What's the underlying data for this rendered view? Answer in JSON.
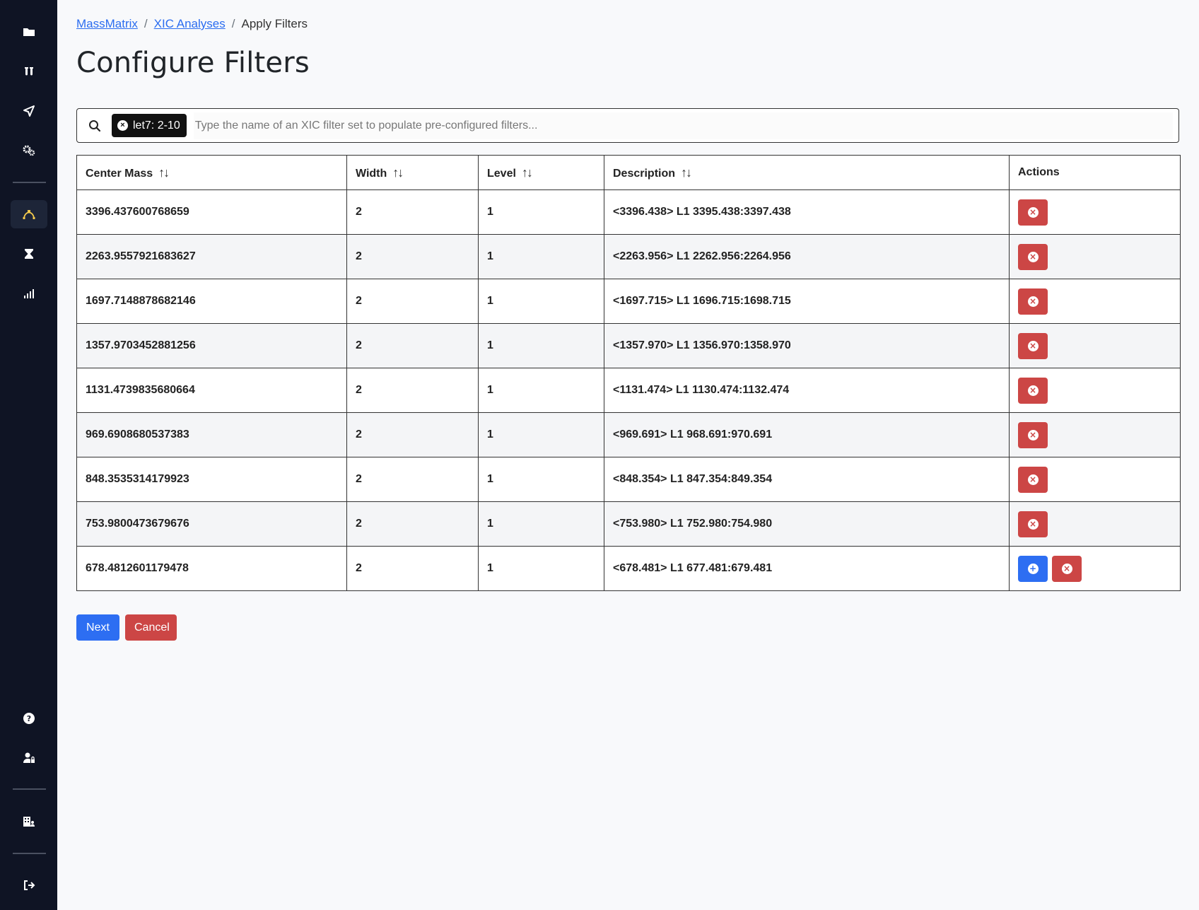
{
  "sidebar": {
    "top_items": [
      {
        "name": "folder",
        "active": false
      },
      {
        "name": "test-tubes",
        "active": false
      },
      {
        "name": "send",
        "active": false
      },
      {
        "name": "gears",
        "active": false
      }
    ],
    "mid_items": [
      {
        "name": "bezier-curve",
        "active": true
      },
      {
        "name": "hourglass",
        "active": false
      },
      {
        "name": "signal",
        "active": false
      }
    ],
    "bottom_items": [
      {
        "name": "help"
      },
      {
        "name": "user-lock"
      },
      {
        "name": "building-user"
      },
      {
        "name": "logout"
      }
    ]
  },
  "breadcrumb": {
    "items": [
      "MassMatrix",
      "XIC Analyses",
      "Apply Filters"
    ],
    "separator": "/"
  },
  "page_title": "Configure Filters",
  "search": {
    "chip_label": "let7: 2-10",
    "placeholder": "Type the name of an XIC filter set to populate pre-configured filters..."
  },
  "table": {
    "headers": {
      "center_mass": "Center Mass",
      "width": "Width",
      "level": "Level",
      "description": "Description",
      "actions": "Actions"
    },
    "rows": [
      {
        "center_mass": "3396.437600768659",
        "width": "2",
        "level": "1",
        "description": "<3396.438> L1 3395.438:3397.438",
        "can_add": false
      },
      {
        "center_mass": "2263.9557921683627",
        "width": "2",
        "level": "1",
        "description": "<2263.956> L1 2262.956:2264.956",
        "can_add": false
      },
      {
        "center_mass": "1697.7148878682146",
        "width": "2",
        "level": "1",
        "description": "<1697.715> L1 1696.715:1698.715",
        "can_add": false
      },
      {
        "center_mass": "1357.9703452881256",
        "width": "2",
        "level": "1",
        "description": "<1357.970> L1 1356.970:1358.970",
        "can_add": false
      },
      {
        "center_mass": "1131.4739835680664",
        "width": "2",
        "level": "1",
        "description": "<1131.474> L1 1130.474:1132.474",
        "can_add": false
      },
      {
        "center_mass": "969.6908680537383",
        "width": "2",
        "level": "1",
        "description": "<969.691> L1 968.691:970.691",
        "can_add": false
      },
      {
        "center_mass": "848.3535314179923",
        "width": "2",
        "level": "1",
        "description": "<848.354> L1 847.354:849.354",
        "can_add": false
      },
      {
        "center_mass": "753.9800473679676",
        "width": "2",
        "level": "1",
        "description": "<753.980> L1 752.980:754.980",
        "can_add": false
      },
      {
        "center_mass": "678.4812601179478",
        "width": "2",
        "level": "1",
        "description": "<678.481> L1 677.481:679.481",
        "can_add": true
      }
    ]
  },
  "buttons": {
    "next": "Next",
    "cancel": "Cancel"
  },
  "colors": {
    "sidebar_bg": "#0f1424",
    "primary": "#2d6ef2",
    "danger": "#cc4645",
    "active_icon": "#f2c94c"
  }
}
